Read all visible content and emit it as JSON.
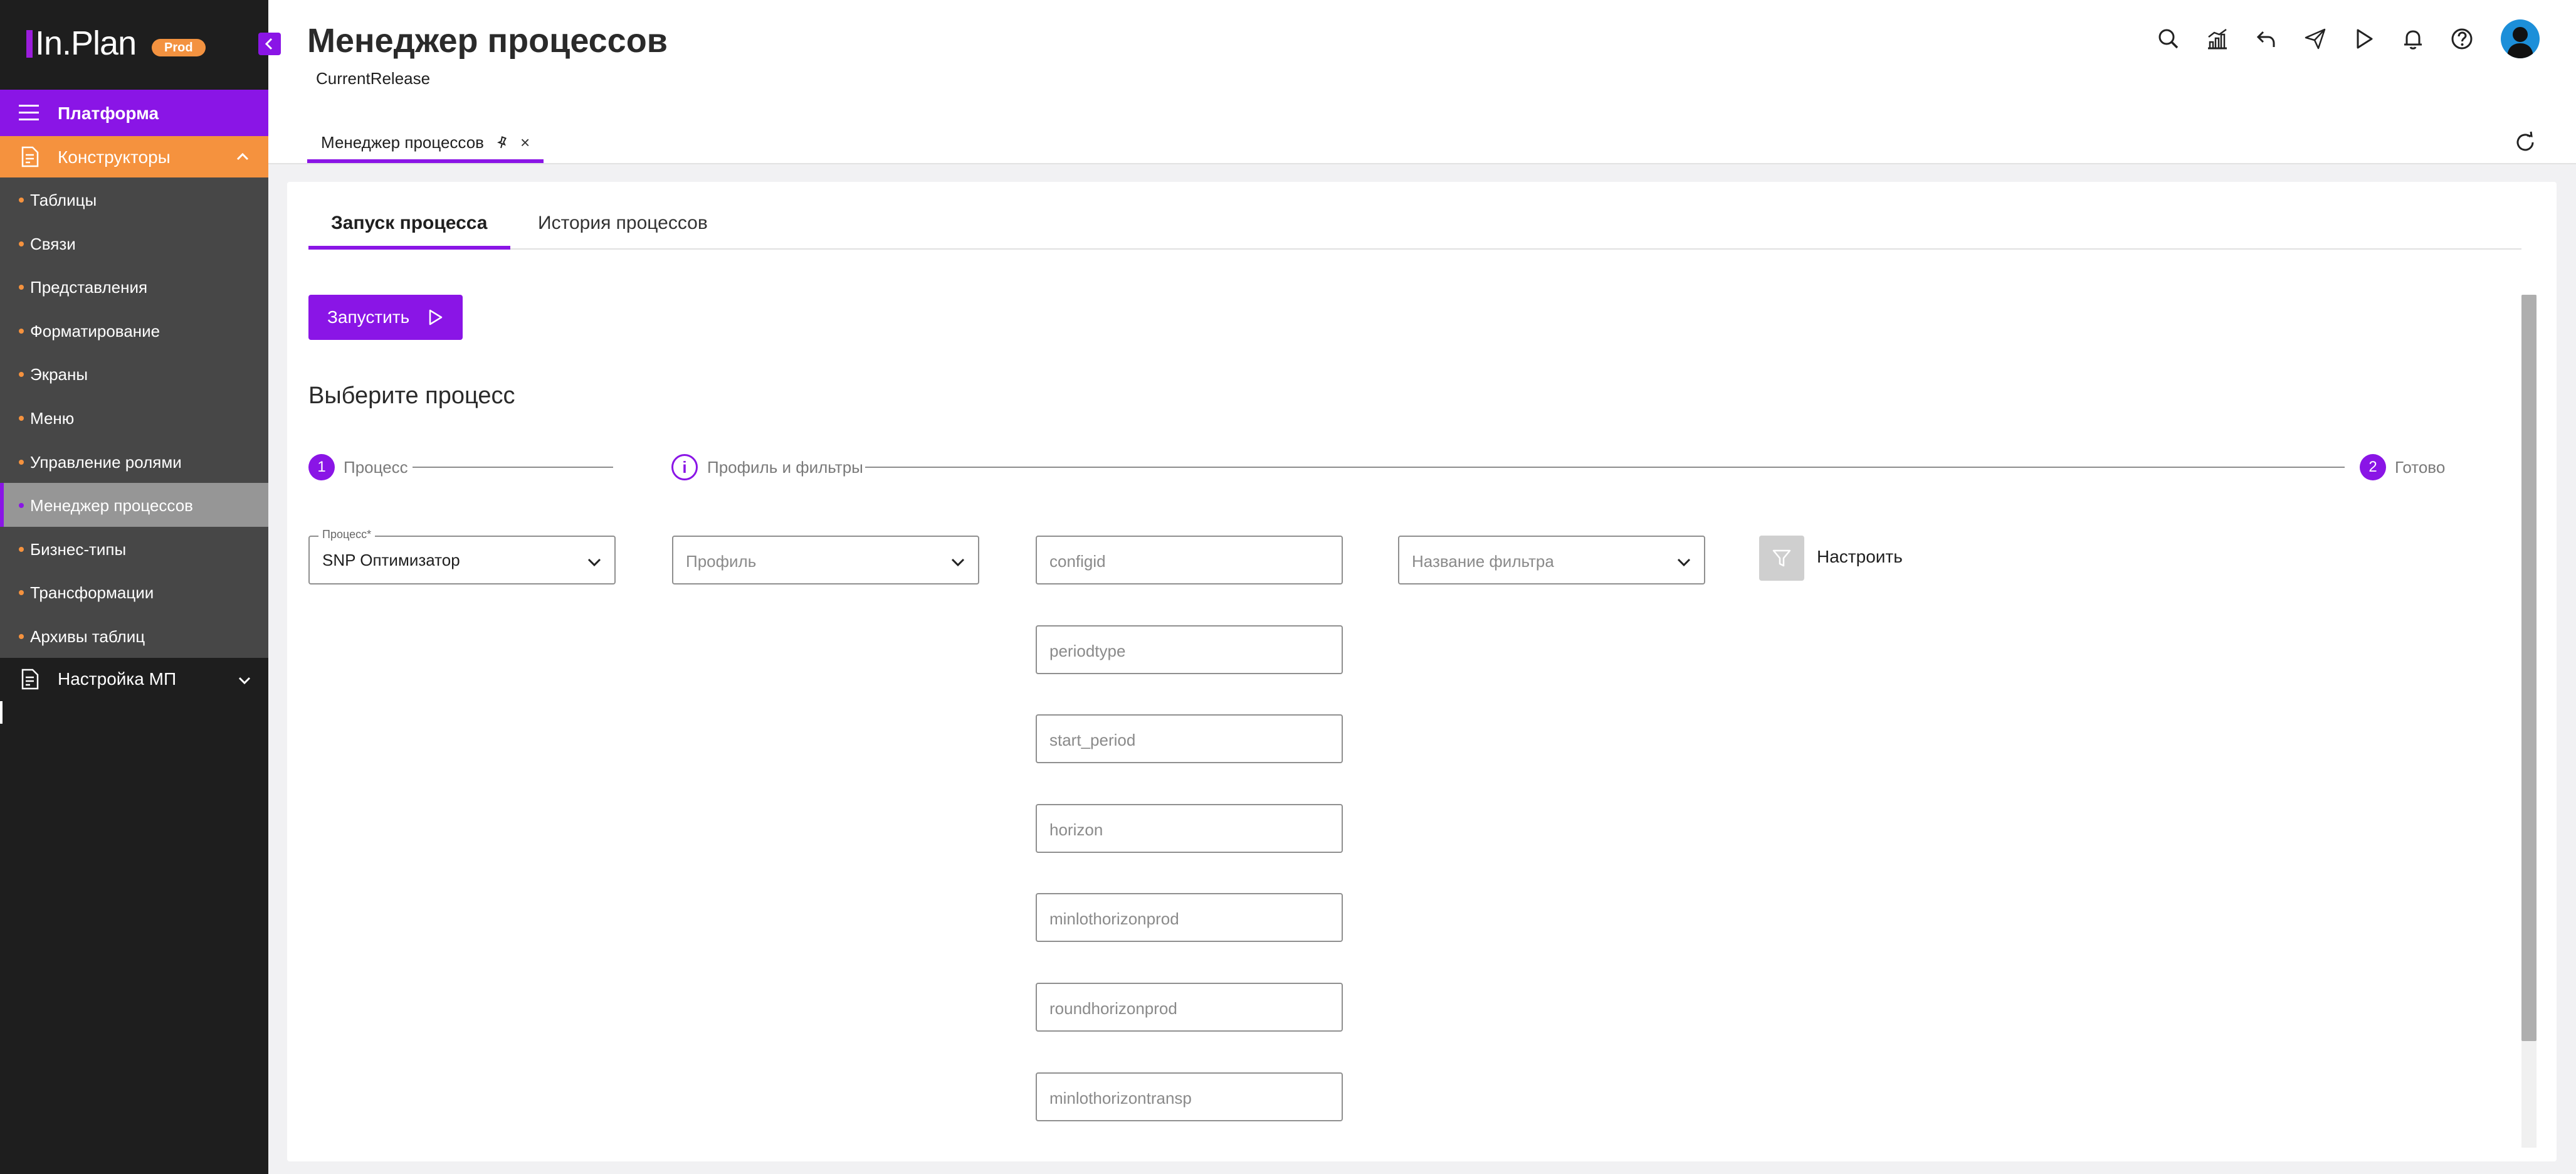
{
  "sidebar": {
    "logo_text": "In.Plan",
    "logo_badge": "Prod",
    "platform_label": "Платформа",
    "constructors_label": "Конструкторы",
    "items": [
      {
        "label": "Таблицы"
      },
      {
        "label": "Связи"
      },
      {
        "label": "Представления"
      },
      {
        "label": "Форматирование"
      },
      {
        "label": "Экраны"
      },
      {
        "label": "Меню"
      },
      {
        "label": "Управление ролями"
      },
      {
        "label": "Менеджер процессов",
        "active": true
      },
      {
        "label": "Бизнес-типы"
      },
      {
        "label": "Трансформации"
      },
      {
        "label": "Архивы таблиц"
      }
    ],
    "mp_settings_label": "Настройка МП"
  },
  "header": {
    "title": "Менеджер процессов",
    "release": "CurrentRelease",
    "icons": [
      "search-icon",
      "chart-icon",
      "undo-icon",
      "send-icon",
      "play-icon",
      "bell-icon",
      "help-icon",
      "avatar"
    ],
    "doc_tab_label": "Менеджер процессов"
  },
  "content": {
    "tabs": [
      {
        "label": "Запуск процесса",
        "active": true
      },
      {
        "label": "История процессов",
        "active": false
      }
    ],
    "run_button": "Запустить",
    "section_title": "Выберите процесс",
    "steps": {
      "step1_num": "1",
      "step1_label": "Процесс",
      "step2_label": "Профиль и фильтры",
      "step3_num": "2",
      "step3_label": "Готово"
    },
    "process_field": {
      "label": "Процесс*",
      "value": "SNP Оптимизатор"
    },
    "profile_field": {
      "placeholder": "Профиль"
    },
    "filter_field": {
      "placeholder": "Название фильтра"
    },
    "params": [
      "configid",
      "periodtype",
      "start_period",
      "horizon",
      "minlothorizonprod",
      "roundhorizonprod",
      "minlothorizontransp"
    ],
    "configure_label": "Настроить"
  },
  "colors": {
    "accent": "#8a15e6",
    "orange": "#f5923e",
    "sidebar_bg": "#1e1e1e",
    "submenu_bg": "#474747"
  }
}
